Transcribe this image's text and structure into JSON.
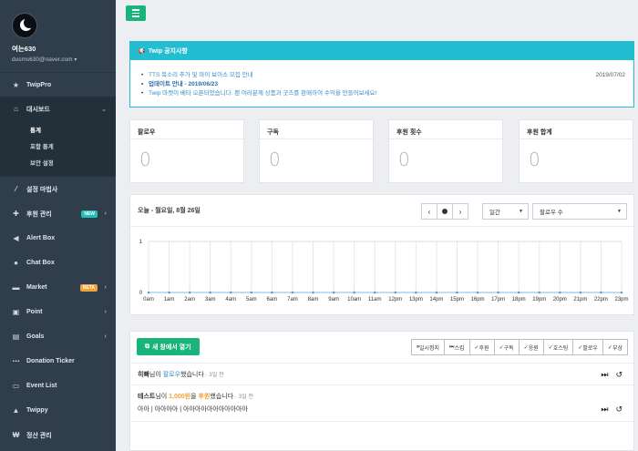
{
  "user": {
    "name": "여는630",
    "email": "dusms630@naver.com"
  },
  "sidebar": {
    "twippro": "TwipPro",
    "dashboard": "대시보드",
    "dashboard_subs": [
      "통계",
      "포함 통계",
      "보안 설정"
    ],
    "items": [
      {
        "label": "설정 마법사",
        "icon": "magic-wand-icon",
        "name": "sidebar-item-wizard"
      },
      {
        "label": "후원 관리",
        "icon": "gift-icon",
        "name": "sidebar-item-donation",
        "badge": "NEW",
        "chevron": true
      },
      {
        "label": "Alert Box",
        "icon": "megaphone-icon",
        "name": "sidebar-item-alertbox"
      },
      {
        "label": "Chat Box",
        "icon": "chat-icon",
        "name": "sidebar-item-chatbox"
      },
      {
        "label": "Market",
        "icon": "cart-icon",
        "name": "sidebar-item-market",
        "badge": "BETA",
        "chevron": true
      },
      {
        "label": "Point",
        "icon": "point-icon",
        "name": "sidebar-item-point",
        "chevron": true
      },
      {
        "label": "Goals",
        "icon": "goals-icon",
        "name": "sidebar-item-goals",
        "chevron": true
      },
      {
        "label": "Donation Ticker",
        "icon": "ticker-icon",
        "name": "sidebar-item-ticker"
      },
      {
        "label": "Event List",
        "icon": "list-icon",
        "name": "sidebar-item-eventlist"
      },
      {
        "label": "Twippy",
        "icon": "bell-icon",
        "name": "sidebar-item-twippy"
      },
      {
        "label": "정산 관리",
        "icon": "won-icon",
        "name": "sidebar-item-settlement"
      }
    ]
  },
  "notice": {
    "title": "Twip 공지사항",
    "items": [
      "TTS 목소리 추가 및 마이 보이스 모집 안내",
      "업데이트 안내 - 2019/06/23",
      "Twip 마켓이 베타 오픈되었습니다. 팬 여러분께 상품과 굿즈를 판매하여 수익을 만들어보세요!"
    ],
    "date": "2019/07/02"
  },
  "stats": [
    {
      "label": "팔로우",
      "value": "0"
    },
    {
      "label": "구독",
      "value": "0"
    },
    {
      "label": "후원 횟수",
      "value": "0"
    },
    {
      "label": "후원 합계",
      "value": "0"
    }
  ],
  "chart_panel": {
    "date_title": "오늘 - 월요일, 8월 26일",
    "period_select": "일간",
    "metric_select": "팔로우 수"
  },
  "chart_data": {
    "type": "line",
    "x": [
      "0am",
      "1am",
      "2am",
      "3am",
      "4am",
      "5am",
      "6am",
      "7am",
      "8am",
      "9am",
      "10am",
      "11am",
      "12pm",
      "13pm",
      "14pm",
      "15pm",
      "16pm",
      "17pm",
      "18pm",
      "19pm",
      "20pm",
      "21pm",
      "22pm",
      "23pm"
    ],
    "series": [
      {
        "values": [
          0,
          0,
          0,
          0,
          0,
          0,
          0,
          0,
          0,
          0,
          0,
          0,
          0,
          0,
          0,
          0,
          0,
          0,
          0,
          0,
          0,
          0,
          0,
          0
        ]
      }
    ],
    "yticks": [
      "1",
      "0"
    ],
    "ylim": [
      0,
      1
    ],
    "grid": true
  },
  "events": {
    "open_button": "새 창에서 열기",
    "filters": [
      "일시정지",
      "스킵",
      "후원",
      "구독",
      "응원",
      "호스팅",
      "팔로우",
      "부상"
    ],
    "rows": [
      {
        "name": "히빠",
        "pre": "님이 ",
        "highlight": "팔로우",
        "post": "했습니다",
        "ago": "· 3일 전"
      },
      {
        "name": "테스트",
        "pre": "님이 ",
        "highlight": "1,000원",
        "mid": "을 ",
        "highlight2": "후원",
        "post": "했습니다",
        "ago": "· 3일 전",
        "message": "아아 | 아아아아 | 아아아아아아아아아아아"
      }
    ]
  },
  "colors": {
    "sidebar": "#2f3e4a",
    "accent": "#18b47b",
    "notice": "#22bdd0",
    "link": "#3a8fc9"
  }
}
